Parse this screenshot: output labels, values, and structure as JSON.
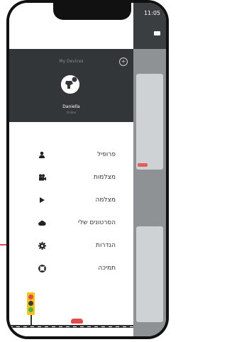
{
  "status_bar": {
    "time": "11:05"
  },
  "drawer": {
    "devices_title": "My Devices",
    "user": {
      "name": "Daniella",
      "subtitle": "Online"
    },
    "menu": [
      {
        "label": "פרופיל",
        "icon": "person-icon"
      },
      {
        "label": "מצלמות",
        "icon": "cameras-icon"
      },
      {
        "label": "מצלמה",
        "icon": "play-icon"
      },
      {
        "label": "הסרטונים שלי",
        "icon": "cloud-icon"
      },
      {
        "label": "הגדרות",
        "icon": "gear-icon"
      },
      {
        "label": "תמיכה",
        "icon": "lifebuoy-icon"
      }
    ]
  },
  "colors": {
    "header_bg": "#333638",
    "accent_arrow": "#e8435a",
    "traffic_yellow": "#f5c518"
  }
}
